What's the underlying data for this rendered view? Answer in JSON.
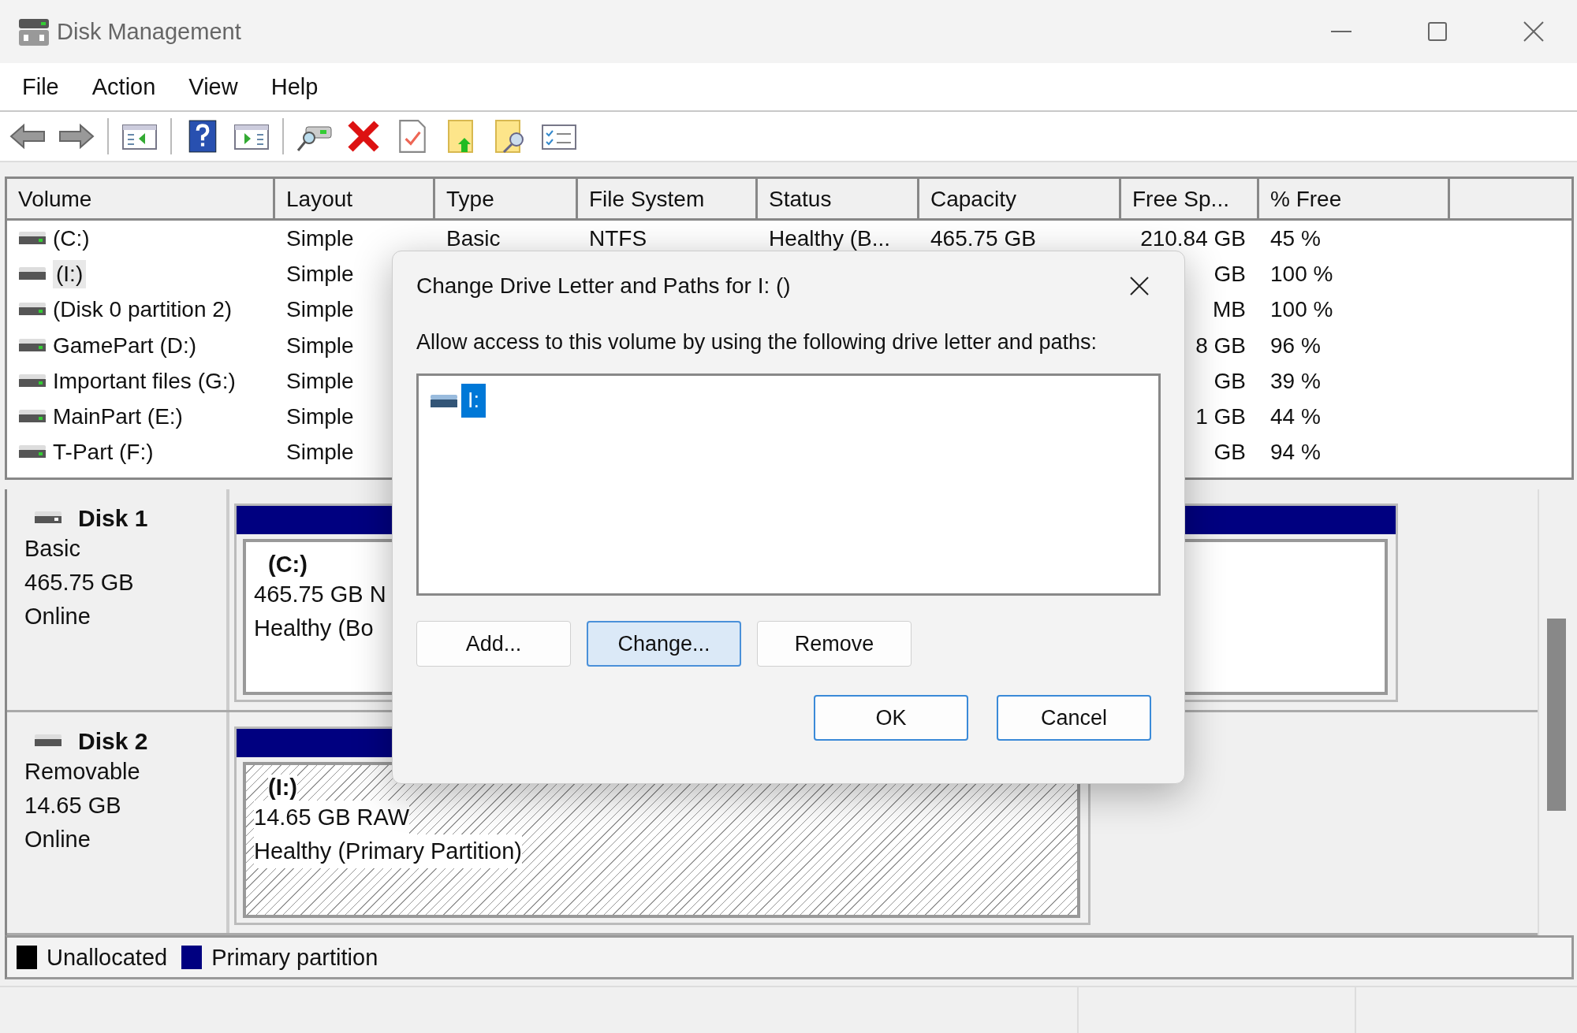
{
  "window": {
    "title": "Disk Management"
  },
  "menu": [
    "File",
    "Action",
    "View",
    "Help"
  ],
  "table": {
    "columns": [
      "Volume",
      "Layout",
      "Type",
      "File System",
      "Status",
      "Capacity",
      "Free Sp...",
      "% Free"
    ],
    "rows": [
      {
        "kind": "fixed",
        "selected": false,
        "cells": [
          "(C:)",
          "Simple",
          "Basic",
          "NTFS",
          "Healthy (B...",
          "465.75 GB",
          "210.84 GB",
          "45 %"
        ]
      },
      {
        "kind": "removable",
        "selected": true,
        "cells": [
          "(I:)",
          "Simple",
          null,
          null,
          null,
          null,
          "GB",
          "100 %"
        ]
      },
      {
        "kind": "fixed",
        "selected": false,
        "cells": [
          "(Disk 0 partition 2)",
          "Simple",
          null,
          null,
          null,
          null,
          "MB",
          "100 %"
        ]
      },
      {
        "kind": "fixed",
        "selected": false,
        "cells": [
          "GamePart (D:)",
          "Simple",
          null,
          null,
          null,
          null,
          "8 GB",
          "96 %"
        ]
      },
      {
        "kind": "fixed",
        "selected": false,
        "cells": [
          "Important files (G:)",
          "Simple",
          null,
          null,
          null,
          null,
          "GB",
          "39 %"
        ]
      },
      {
        "kind": "fixed",
        "selected": false,
        "cells": [
          "MainPart (E:)",
          "Simple",
          null,
          null,
          null,
          null,
          "1 GB",
          "44 %"
        ]
      },
      {
        "kind": "fixed",
        "selected": false,
        "cells": [
          "T-Part (F:)",
          "Simple",
          null,
          null,
          null,
          null,
          "GB",
          "94 %"
        ]
      }
    ]
  },
  "disks": [
    {
      "kind": "fixed",
      "name": "Disk 1",
      "lines": [
        "Basic",
        "465.75 GB",
        "Online"
      ],
      "partition": {
        "selected": false,
        "name": "(C:)",
        "lines": [
          "465.75 GB N",
          "Healthy (Bo"
        ]
      }
    },
    {
      "kind": "removable",
      "name": "Disk 2",
      "lines": [
        "Removable",
        "14.65 GB",
        "Online"
      ],
      "partition": {
        "selected": true,
        "name": "(I:)",
        "lines": [
          "14.65 GB RAW",
          "Healthy (Primary Partition)"
        ]
      }
    }
  ],
  "legend": [
    {
      "label": "Unallocated",
      "color": "#000000"
    },
    {
      "label": "Primary partition",
      "color": "#000080"
    }
  ],
  "dialog": {
    "title": "Change Drive Letter and Paths for I: ()",
    "prompt": "Allow access to this volume by using the following drive letter and paths:",
    "paths": [
      {
        "label": "I:",
        "selected": true
      }
    ],
    "path_buttons": [
      {
        "label": "Add...",
        "highlighted": false
      },
      {
        "label": "Change...",
        "highlighted": true
      },
      {
        "label": "Remove",
        "highlighted": false
      }
    ],
    "buttons": [
      "OK",
      "Cancel"
    ]
  }
}
